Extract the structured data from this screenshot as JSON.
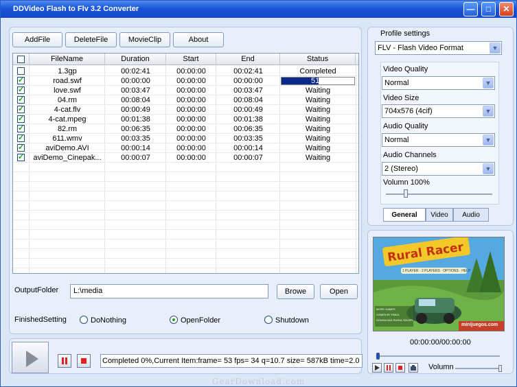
{
  "window": {
    "title": "DDVideo Flash to Flv 3.2 Converter"
  },
  "titlebar_buttons": {
    "minimize": "—",
    "maximize": "□",
    "close": "✕"
  },
  "toolbar": {
    "add_file": "AddFile",
    "delete_file": "DeleteFile",
    "movie_clip": "MovieClip",
    "about": "About"
  },
  "table": {
    "columns": [
      "FileName",
      "Duration",
      "Start",
      "End",
      "Status"
    ],
    "rows": [
      {
        "checked": false,
        "name": "1.3gp",
        "duration": "00:02:41",
        "start": "00:00:00",
        "end": "00:02:41",
        "status": "Completed"
      },
      {
        "checked": true,
        "name": "road.swf",
        "duration": "00:00:00",
        "start": "00:00:00",
        "end": "00:00:00",
        "status": "51%",
        "progress": 0.51
      },
      {
        "checked": true,
        "name": "love.swf",
        "duration": "00:03:47",
        "start": "00:00:00",
        "end": "00:03:47",
        "status": "Waiting"
      },
      {
        "checked": true,
        "name": "04.rm",
        "duration": "00:08:04",
        "start": "00:00:00",
        "end": "00:08:04",
        "status": "Waiting"
      },
      {
        "checked": true,
        "name": "4-cat.flv",
        "duration": "00:00:49",
        "start": "00:00:00",
        "end": "00:00:49",
        "status": "Waiting"
      },
      {
        "checked": true,
        "name": "4-cat.mpeg",
        "duration": "00:01:38",
        "start": "00:00:00",
        "end": "00:01:38",
        "status": "Waiting"
      },
      {
        "checked": true,
        "name": "82.rm",
        "duration": "00:06:35",
        "start": "00:00:00",
        "end": "00:06:35",
        "status": "Waiting"
      },
      {
        "checked": true,
        "name": "611.wmv",
        "duration": "00:03:35",
        "start": "00:00:00",
        "end": "00:03:35",
        "status": "Waiting"
      },
      {
        "checked": true,
        "name": "aviDemo.AVI",
        "duration": "00:00:14",
        "start": "00:00:00",
        "end": "00:00:14",
        "status": "Waiting"
      },
      {
        "checked": true,
        "name": "aviDemo_Cinepak...",
        "duration": "00:00:07",
        "start": "00:00:00",
        "end": "00:00:07",
        "status": "Waiting"
      }
    ]
  },
  "output": {
    "label": "OutputFolder",
    "value": "L:\\media",
    "browse": "Browe",
    "open": "Open"
  },
  "finished": {
    "label": "FinishedSetting",
    "options": [
      "DoNothing",
      "OpenFolder",
      "Shutdown"
    ],
    "selected": "OpenFolder"
  },
  "status_text": "Completed 0%,Current Item:frame=   53 fps= 34 q=10.7 size=      587kB time=2.0",
  "profile": {
    "label": "Profile settings",
    "value": "FLV - Flash Video Format",
    "video_quality_label": "Video Quality",
    "video_quality": "Normal",
    "video_size_label": "Video Size",
    "video_size": "704x576 (4cif)",
    "audio_quality_label": "Audio Quality",
    "audio_quality": "Normal",
    "audio_channels_label": "Audio Channels",
    "audio_channels": "2 (Stereo)",
    "volume_label": "Volumn 100%",
    "volume_level": 0.1,
    "tabs": [
      "General",
      "Video",
      "Audio"
    ],
    "active_tab": "General"
  },
  "preview": {
    "title": "Rural Racer",
    "subtitle": "1 PLAYER · 2 PLAYERS · OPTIONS · HELP",
    "menu_left": [
      "MORE GAMES",
      "GAMES BY EMAIL",
      "DOWNLOAD RURAL RACER"
    ],
    "site": "minijuegos.com",
    "time": "00:00:00/00:00:00",
    "volume_label": "Volumn"
  },
  "footer": "GearDownload.com",
  "colors": {
    "title_bar": "#1a55d8",
    "progress": "#0b2a8a",
    "check": "#21a121"
  }
}
